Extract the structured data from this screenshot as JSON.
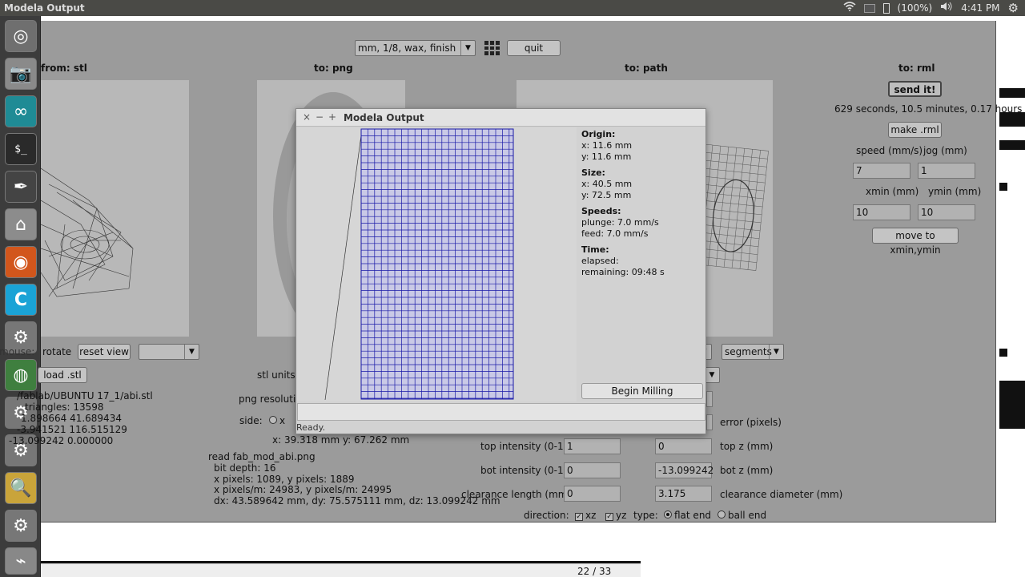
{
  "top_panel": {
    "app_title": "Modela Output",
    "battery": "(100%)",
    "time": "4:41 PM"
  },
  "launcher": {
    "items": [
      "ubuntu-icon",
      "camera-icon",
      "arduino-icon",
      "terminal-icon",
      "inkscape-icon",
      "files-icon",
      "firefox-icon",
      "cura-icon",
      "settings-icon",
      "chrome-icon",
      "settings-icon",
      "settings-icon",
      "scanner-icon",
      "settings-icon",
      "usb-icon"
    ]
  },
  "toolbar": {
    "material_select": "mm, 1/8, wax, finish",
    "quit_label": "quit"
  },
  "headers": {
    "from_stl": "from: stl",
    "to_png": "to: png",
    "to_path": "to: path",
    "to_rml": "to: rml"
  },
  "stl_pane": {
    "rotate_label": "rotate",
    "rotate_prefix": "mouse:",
    "reset_view_label": "reset view",
    "load_stl_label": "load .stl",
    "file_path": "/fablab/UBUNTU 17_1/abi.stl",
    "triangles": "triangles: 13598",
    "line_1": "1.898664 41.689434",
    "line_2": "-3.941521 116.515129",
    "line_3": "-13.099242 0.000000"
  },
  "png_pane": {
    "stl_units_label": "stl units (",
    "png_resolution_label": "png resolution",
    "side_label": "side:",
    "side_option": "x",
    "xy_readout": "x: 39.318 mm  y: 67.262 mm",
    "read_file": "read fab_mod_abi.png",
    "bit_depth": "bit depth: 16",
    "pixels": "x pixels: 1089, y pixels: 1889",
    "pixels_per_m": "x pixels/m: 24983, y pixels/m: 24995",
    "dims": "dx: 43.589642 mm, dy: 75.575111 mm, dz: 13.099242 mm"
  },
  "path_pane": {
    "segments_select": "segments",
    "error_label": "error (pixels)",
    "top_intensity_label": "top intensity (0-1)",
    "top_intensity": "1",
    "top_z_label": "top z (mm)",
    "top_z": "0",
    "bot_intensity_label": "bot intensity (0-1)",
    "bot_intensity": "0",
    "bot_z_label": "bot z (mm)",
    "bot_z": "-13.099242",
    "clearance_length_label": "clearance length (mm)",
    "clearance_length": "0",
    "clearance_diameter_label": "clearance diameter (mm)",
    "clearance_diameter": "3.175",
    "direction_label": "direction:",
    "dir_xz": "xz",
    "dir_yz": "yz",
    "type_label": "type:",
    "type_flat": "flat end",
    "type_ball": "ball end"
  },
  "rml_pane": {
    "send_label": "send it!",
    "time_estimate": "629 seconds, 10.5 minutes, 0.17 hours",
    "make_rml_label": "make .rml",
    "speed_label": "speed (mm/s)",
    "speed": "7",
    "jog_label": "jog (mm)",
    "jog": "1",
    "xmin_label": "xmin (mm)",
    "xmin": "10",
    "ymin_label": "ymin (mm)",
    "ymin": "10",
    "move_label": "move to xmin,ymin"
  },
  "dialog": {
    "title": "Modela Output",
    "origin_title": "Origin:",
    "origin_x": "x: 11.6 mm",
    "origin_y": "y: 11.6 mm",
    "size_title": "Size:",
    "size_x": "x: 40.5 mm",
    "size_y": "y: 72.5 mm",
    "speeds_title": "Speeds:",
    "plunge": "plunge: 7.0 mm/s",
    "feed": "feed: 7.0 mm/s",
    "time_title": "Time:",
    "elapsed": "elapsed:",
    "remaining": "remaining: 09:48 s",
    "begin_label": "Begin Milling",
    "status": "Ready."
  },
  "background_doc": {
    "page_counter": "22 / 33"
  },
  "colors": {
    "grid": "#1a1aa8",
    "panel": "#4a4a46",
    "window": "#9b9b9b"
  }
}
